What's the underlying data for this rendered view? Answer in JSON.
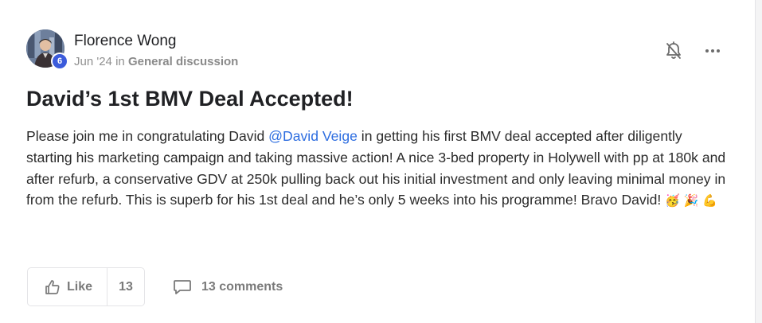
{
  "post": {
    "author": {
      "name": "Florence Wong",
      "level": "6"
    },
    "meta": {
      "date": "Jun '24",
      "in_word": "in",
      "category": "General discussion"
    },
    "title": "David’s 1st BMV Deal Accepted!",
    "body": {
      "before_mention": "Please join me in congratulating David ",
      "mention": "@David Veige",
      "after_mention": " in getting his first BMV deal accepted after diligently starting his marketing campaign and taking massive action! A nice 3-bed property in Holywell with pp at 180k and after refurb, a conservative GDV at 250k pulling back out his initial investment and only leaving minimal money in from the refurb. This is superb for his 1st deal and he’s only 5 weeks into his programme! Bravo David! ",
      "emojis": [
        "🥳",
        "🎉",
        "💪"
      ]
    },
    "actions": {
      "like_label": "Like",
      "like_count": "13",
      "comments_label": "13 comments"
    },
    "icons": {
      "notification": "bell-off-icon",
      "more": "more-horizontal-icon",
      "like": "thumbs-up-icon",
      "comments": "comment-bubble-icon"
    },
    "colors": {
      "mention": "#2d6de0",
      "level_badge": "#3b5bdb",
      "muted_text": "#7a7a7a"
    }
  }
}
